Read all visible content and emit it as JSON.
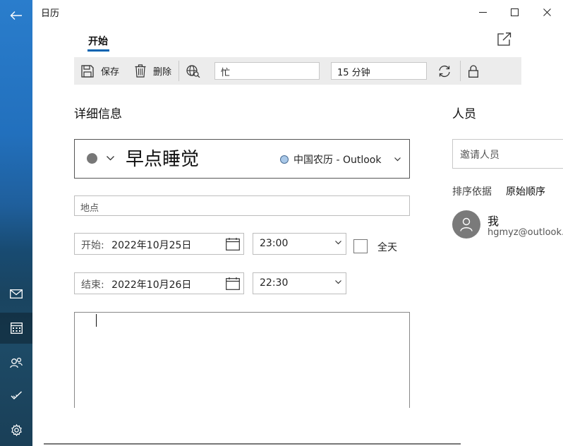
{
  "window": {
    "title": "日历"
  },
  "tabs": [
    {
      "label": "开始",
      "active": true
    }
  ],
  "toolbar": {
    "save_label": "保存",
    "delete_label": "删除",
    "show_as_value": "忙",
    "reminder_value": "15 分钟"
  },
  "details": {
    "heading": "详细信息",
    "event_title": "早点睡觉",
    "calendar_name": "中国农历 - Outlook",
    "location_placeholder": "地点",
    "start": {
      "label": "开始:",
      "date": "2022年10月25日",
      "time": "23:00"
    },
    "end": {
      "label": "结束:",
      "date": "2022年10月26日",
      "time": "22:30"
    },
    "all_day_label": "全天",
    "all_day_checked": false
  },
  "people": {
    "heading": "人员",
    "invite_placeholder": "邀请人员",
    "sort_label": "排序依据",
    "sort_value": "原始顺序",
    "attendees": [
      {
        "name": "我",
        "email": "hgmyz@outlook."
      }
    ]
  },
  "colors": {
    "accent": "#0063b1",
    "rail_top": "#2a7dcc",
    "event_dot": "#777777",
    "calendar_dot": "#a9c8e8"
  },
  "icons": {
    "rail": [
      "back-arrow-icon",
      "mail-icon",
      "calendar-icon",
      "people-icon",
      "todo-icon",
      "settings-icon"
    ],
    "toolbar": [
      "save-icon",
      "delete-icon",
      "online-meeting-icon",
      "repeat-icon",
      "lock-icon"
    ]
  }
}
